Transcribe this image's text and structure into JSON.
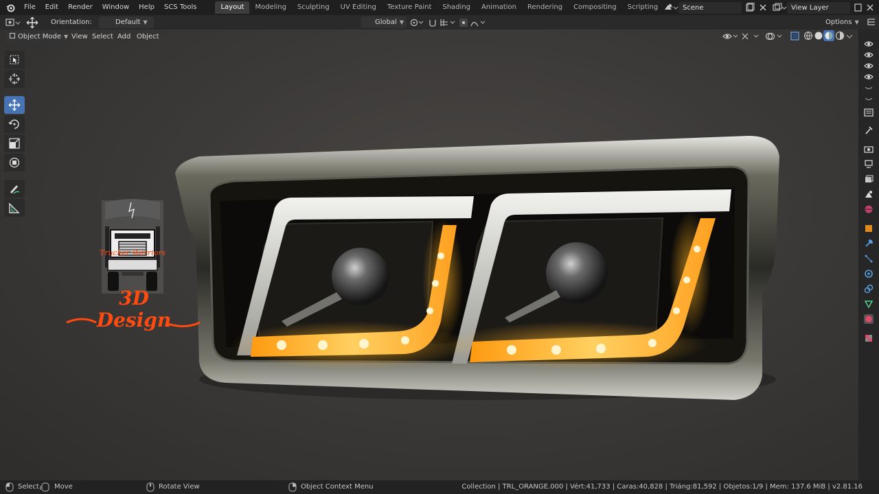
{
  "topbar": {
    "menu": [
      "File",
      "Edit",
      "Render",
      "Window",
      "Help",
      "SCS Tools"
    ],
    "tabs": [
      {
        "label": "Layout",
        "active": true
      },
      {
        "label": "Modeling",
        "active": false
      },
      {
        "label": "Sculpting",
        "active": false
      },
      {
        "label": "UV Editing",
        "active": false
      },
      {
        "label": "Texture Paint",
        "active": false
      },
      {
        "label": "Shading",
        "active": false
      },
      {
        "label": "Animation",
        "active": false
      },
      {
        "label": "Rendering",
        "active": false
      },
      {
        "label": "Compositing",
        "active": false
      },
      {
        "label": "Scripting",
        "active": false
      }
    ],
    "add_tab": "+",
    "scene": "Scene",
    "view_layer": "View Layer"
  },
  "header": {
    "orientation_label": "Orientation:",
    "orientation_value": "Default",
    "transform_space": "Global",
    "options": "Options"
  },
  "viewport_header": {
    "mode": "Object Mode",
    "view": "View",
    "select": "Select",
    "add": "Add",
    "object": "Object"
  },
  "logo": {
    "brand_top": "Trucker Warriors",
    "brand_3d": "3D",
    "brand_design": "Design"
  },
  "statusbar": {
    "select": "Select",
    "move": "Move",
    "rotate_view": "Rotate View",
    "context_menu": "Object Context Menu",
    "stats": "Collection | TRL_ORANGE.000 | Vért:41,733 | Caras:40,828 | Triáng:81,592 | Objetos:1/9 | Mem: 137.6 MiB | v2.81.16"
  },
  "colors": {
    "accent": "#4772b3",
    "led": "#ffb020",
    "brand": "#ff4a10"
  }
}
